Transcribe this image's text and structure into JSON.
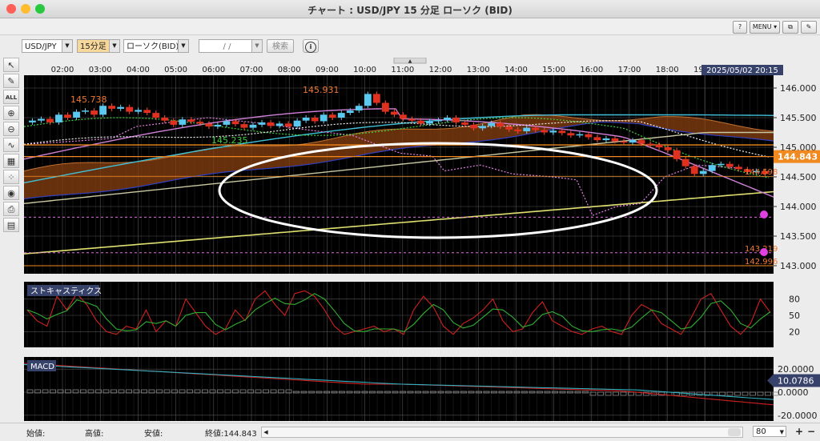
{
  "window": {
    "title": "チャート : USD/JPY 15 分足 ローソク (BID)"
  },
  "toolbar": {
    "help": "?",
    "menu": "MENU ▾",
    "b3": "⧉",
    "b4": "✎"
  },
  "controls": {
    "pair": "USD/JPY",
    "interval": "15分足",
    "chart_type": "ローソク(BID)",
    "date": "/ /",
    "search": "検索",
    "info_icon": "i"
  },
  "left_tools": [
    "cursor-icon",
    "pen-icon",
    "all-icon",
    "zoom-in-icon",
    "zoom-out-icon",
    "line-chart-icon",
    "grid-icon",
    "dots-icon",
    "eye-icon",
    "print-icon",
    "table-icon"
  ],
  "time_axis": [
    "02:00",
    "03:00",
    "04:00",
    "05:00",
    "06:00",
    "07:00",
    "08:00",
    "09:00",
    "10:00",
    "11:00",
    "12:00",
    "13:00",
    "14:00",
    "15:00",
    "16:00",
    "17:00",
    "18:00",
    "19:00"
  ],
  "datetime_label": "2025/05/02 20:15",
  "price_axis": [
    "146.000",
    "145.500",
    "145.000",
    "144.500",
    "144.000",
    "143.500",
    "143.000"
  ],
  "price_labels": {
    "current": "144.843",
    "high": "145.931",
    "left_high": "145.738",
    "low": "145.235",
    "right_mid": "144.598",
    "line1": "143.219",
    "line2": "142.996"
  },
  "stochastics": {
    "title": "ストキャスティクス",
    "axis": [
      "80",
      "50",
      "20"
    ]
  },
  "macd": {
    "title": "MACD",
    "axis": [
      "20.0000",
      "10.0786",
      "0.0000",
      "-20.0000"
    ]
  },
  "status": {
    "open": "始値:",
    "high": "高値:",
    "low": "安値:",
    "close": "終値:144.843",
    "zoom": "80"
  },
  "colors": {
    "bull": "#5bc8f0",
    "bear": "#e03020",
    "cloud": "#8a4010",
    "current_price": "#f08a20"
  }
}
